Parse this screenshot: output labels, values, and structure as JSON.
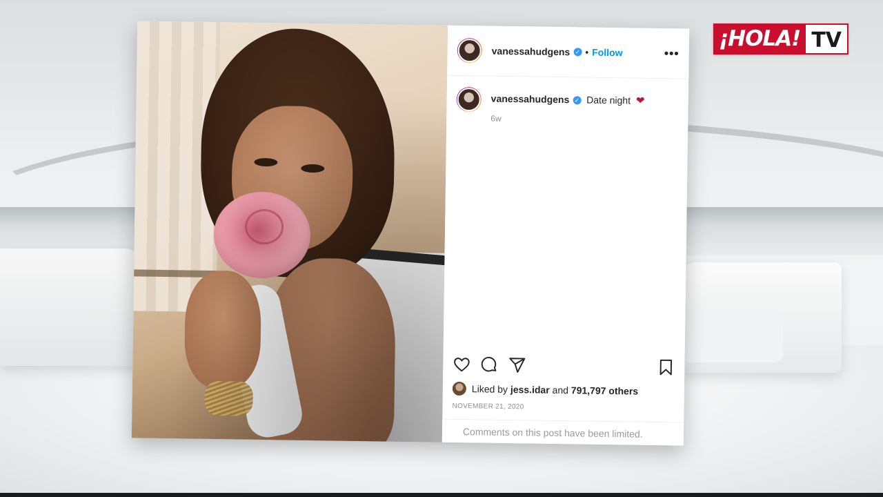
{
  "brand": {
    "hola": "¡HOLA!",
    "tv": "TV"
  },
  "post": {
    "username": "vanessahudgens",
    "verified_mark": "✓",
    "separator": "•",
    "follow_label": "Follow",
    "more_label": "•••",
    "caption_user": "vanessahudgens",
    "caption_text": "Date night",
    "caption_emoji": "❤",
    "time_ago": "6w",
    "liked_by_prefix": "Liked by",
    "liked_by_user": "jess.idar",
    "liked_by_and": "and",
    "liked_by_count": "791,797 others",
    "date": "NOVEMBER 21, 2020",
    "comments_notice": "Comments on this post have been limited.",
    "icons": [
      "heart-icon",
      "comment-icon",
      "share-icon",
      "bookmark-icon",
      "more-icon"
    ]
  },
  "colors": {
    "brand_red": "#c8102e",
    "link_blue": "#0095f6",
    "verified_blue": "#3897f0"
  }
}
